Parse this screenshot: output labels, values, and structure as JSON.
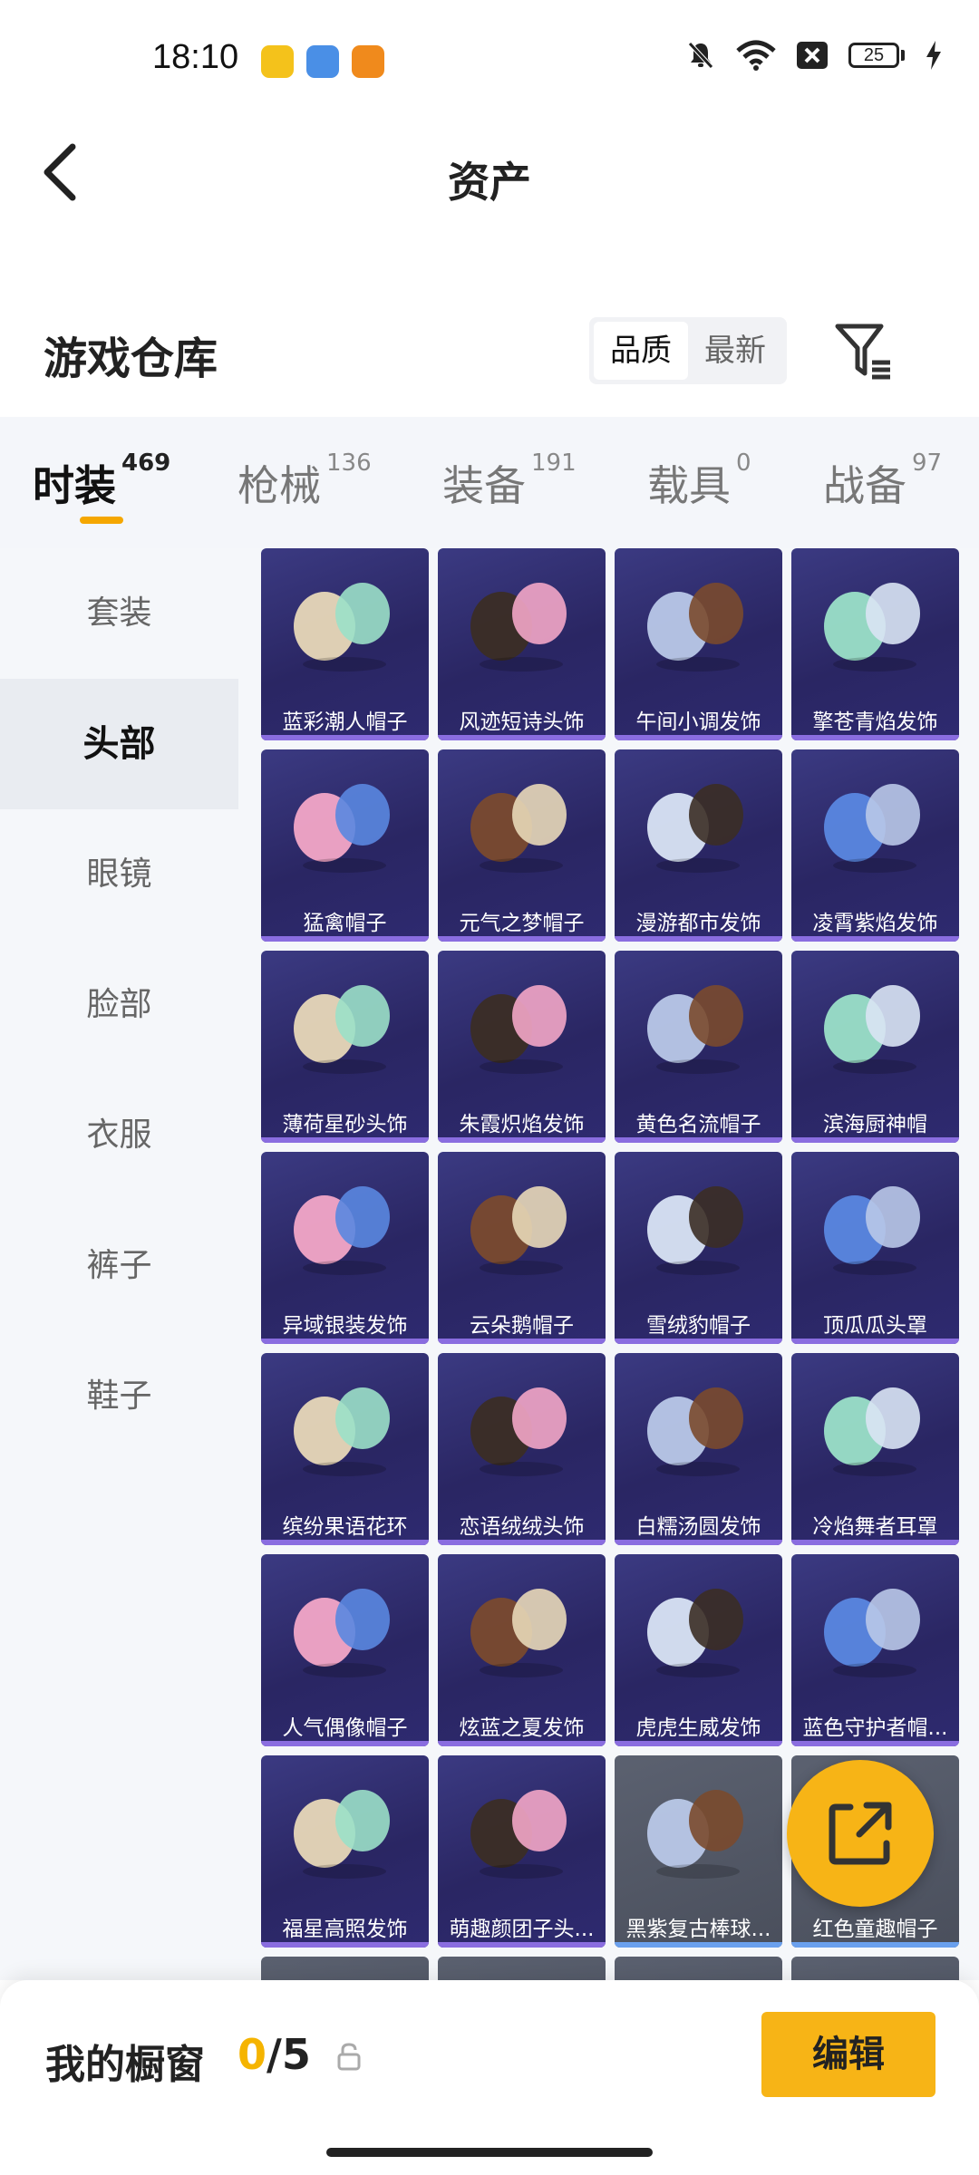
{
  "status_bar": {
    "time": "18:10",
    "battery": "25",
    "app_icons": [
      {
        "name": "app-icon-yellow",
        "color": "#f4c21b"
      },
      {
        "name": "app-icon-weather",
        "color": "#4a8fe6"
      },
      {
        "name": "app-icon-orange",
        "color": "#f08a1c"
      }
    ]
  },
  "header": {
    "title": "资产"
  },
  "warehouse": {
    "title": "游戏仓库",
    "sort_options": [
      "品质",
      "最新"
    ],
    "active_sort": "品质"
  },
  "tabs": [
    {
      "label": "时装",
      "count": "469"
    },
    {
      "label": "枪械",
      "count": "136"
    },
    {
      "label": "装备",
      "count": "191"
    },
    {
      "label": "载具",
      "count": "0"
    },
    {
      "label": "战备",
      "count": "97"
    }
  ],
  "sidebar": {
    "items": [
      "套装",
      "头部",
      "眼镜",
      "脸部",
      "衣服",
      "裤子",
      "鞋子"
    ],
    "active": "头部"
  },
  "items": [
    {
      "name": "蓝彩潮人帽子",
      "icon": "cap-icon"
    },
    {
      "name": "风迹短诗头饰",
      "icon": "hair-icon"
    },
    {
      "name": "午间小调发饰",
      "icon": "hair-icon"
    },
    {
      "name": "擎苍青焰发饰",
      "icon": "hair-icon"
    },
    {
      "name": "猛禽帽子",
      "icon": "aviator-helmet-icon"
    },
    {
      "name": "元气之梦帽子",
      "icon": "hair-icon"
    },
    {
      "name": "漫游都市发饰",
      "icon": "hair-icon"
    },
    {
      "name": "凌霄紫焰发饰",
      "icon": "hair-icon"
    },
    {
      "name": "薄荷星砂头饰",
      "icon": "hair-icon"
    },
    {
      "name": "朱霞炽焰发饰",
      "icon": "hair-icon"
    },
    {
      "name": "黄色名流帽子",
      "icon": "fedora-icon"
    },
    {
      "name": "滨海厨神帽",
      "icon": "flat-cap-icon"
    },
    {
      "name": "异域银装发饰",
      "icon": "hair-icon"
    },
    {
      "name": "云朵鹅帽子",
      "icon": "goose-hat-icon"
    },
    {
      "name": "雪绒豹帽子",
      "icon": "hair-icon"
    },
    {
      "name": "顶瓜瓜头罩",
      "icon": "watermelon-icon"
    },
    {
      "name": "缤纷果语花环",
      "icon": "flower-wreath-icon"
    },
    {
      "name": "恋语绒绒头饰",
      "icon": "hair-icon"
    },
    {
      "name": "白糯汤圆发饰",
      "icon": "hair-icon"
    },
    {
      "name": "冷焰舞者耳罩",
      "icon": "earmuff-icon"
    },
    {
      "name": "人气偶像帽子",
      "icon": "beret-icon"
    },
    {
      "name": "炫蓝之夏发饰",
      "icon": "hair-icon"
    },
    {
      "name": "虎虎生威发饰",
      "icon": "hair-icon"
    },
    {
      "name": "蓝色守护者帽...",
      "icon": "police-cap-icon"
    },
    {
      "name": "福星高照发饰",
      "icon": "hair-icon"
    },
    {
      "name": "萌趣颜团子头...",
      "icon": "dumpling-icon"
    },
    {
      "name": "黑紫复古棒球...",
      "icon": "cap-icon"
    },
    {
      "name": "红色童趣帽子",
      "icon": "hat-icon"
    }
  ],
  "showcase": {
    "label": "我的橱窗",
    "current": "0",
    "separator": "/",
    "max": "5",
    "edit_label": "编辑"
  },
  "colors": {
    "accent": "#f7b416",
    "card_purple": "#2a2663",
    "card_grey": "#4a4f5c"
  }
}
